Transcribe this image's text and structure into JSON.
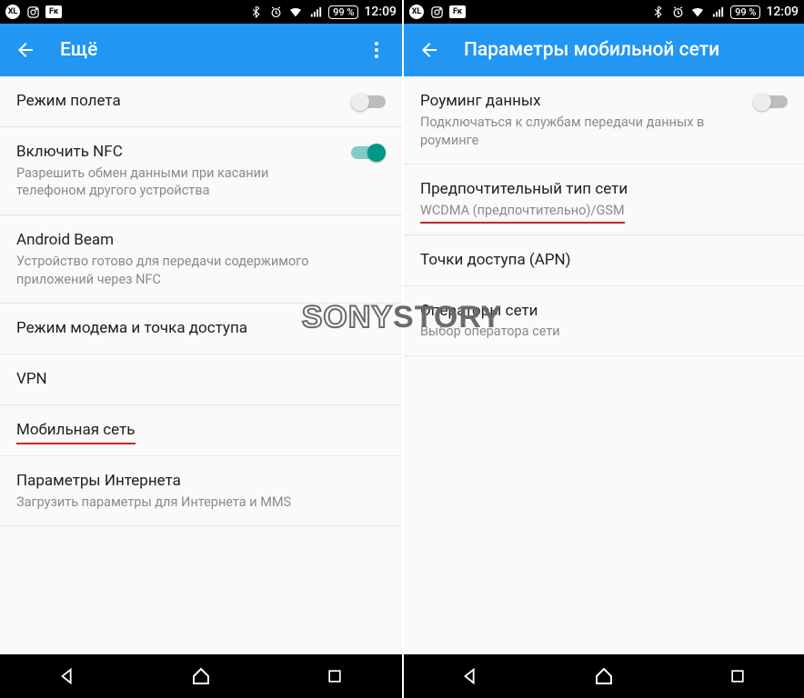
{
  "status": {
    "battery": "99 %",
    "time": "12:09"
  },
  "left": {
    "title": "Ещё",
    "items": {
      "airplane": {
        "title": "Режим полета"
      },
      "nfc": {
        "title": "Включить NFC",
        "sub": "Разрешить обмен данными при касании телефоном другого устройства"
      },
      "beam": {
        "title": "Android Beam",
        "sub": "Устройство готово для передачи содержимого приложений через NFC"
      },
      "tether": {
        "title": "Режим модема и точка доступа"
      },
      "vpn": {
        "title": "VPN"
      },
      "mobile": {
        "title": "Мобильная сеть"
      },
      "internet": {
        "title": "Параметры Интернета",
        "sub": "Загрузить параметры для Интернета и MMS"
      }
    }
  },
  "right": {
    "title": "Параметры мобильной сети",
    "items": {
      "roaming": {
        "title": "Роуминг данных",
        "sub": "Подключаться к службам передачи данных в роуминге"
      },
      "preferred": {
        "title": "Предпочтительный тип сети",
        "sub": "WCDMA (предпочтительно)/GSM"
      },
      "apn": {
        "title": "Точки доступа (APN)"
      },
      "operators": {
        "title": "Операторы сети",
        "sub": "Выбор оператора сети"
      }
    }
  },
  "watermark": {
    "a": "SONY",
    "b": "STORY"
  }
}
